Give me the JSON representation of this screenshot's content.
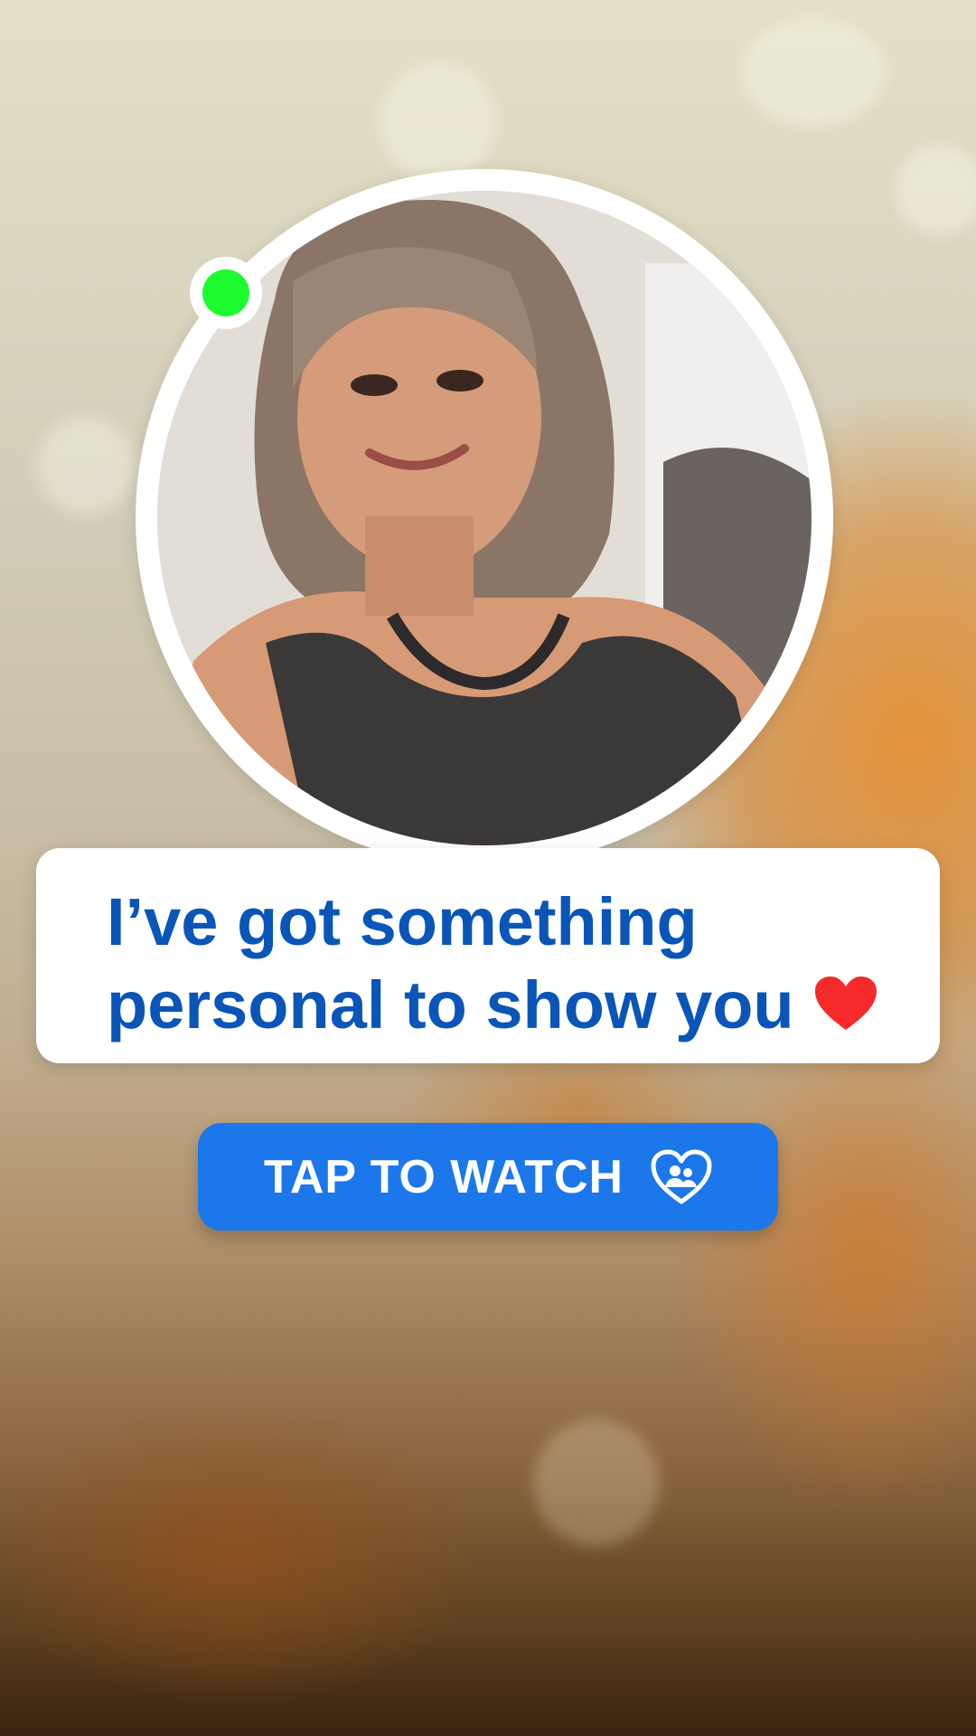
{
  "card": {
    "line1": "I’ve got something",
    "line2": "personal to show you"
  },
  "cta": {
    "label": "TAP TO WATCH"
  },
  "icons": {
    "heart": "heart-icon",
    "cta": "heart-people-icon",
    "status": "online-status-dot"
  },
  "colors": {
    "text_blue": "#0a55b8",
    "button_blue": "#1b77ea",
    "online_green": "#1dfb30",
    "heart_red": "#f52a2a"
  }
}
